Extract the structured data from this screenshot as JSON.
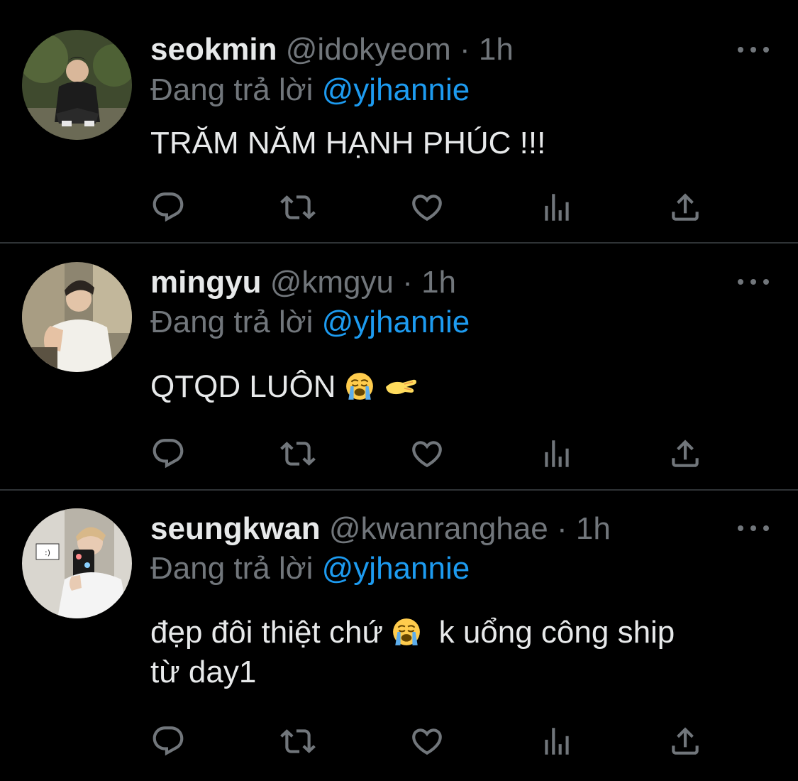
{
  "tweets": [
    {
      "display_name": "seokmin",
      "handle": "@idokyeom",
      "separator": "·",
      "time": "1h",
      "reply_prefix": "Đang trả lời",
      "reply_to": "@yjhannie",
      "text": "TRĂM NĂM HẠNH PHÚC !!!",
      "text_suffix": ""
    },
    {
      "display_name": "mingyu",
      "handle": "@kmgyu",
      "separator": "·",
      "time": "1h",
      "reply_prefix": "Đang trả lời",
      "reply_to": "@yjhannie",
      "text": "QTQD LUÔN",
      "emojis": [
        "loudly-crying-face",
        "pinching-hand"
      ]
    },
    {
      "display_name": "seungkwan",
      "handle": "@kwanranghae",
      "separator": "·",
      "time": "1h",
      "reply_prefix": "Đang trả lời",
      "reply_to": "@yjhannie",
      "text": "đẹp đôi thiệt chứ",
      "text_after_emoji": "k uổng công ship",
      "text_line2": "từ day1",
      "emojis": [
        "loudly-crying-face"
      ]
    }
  ],
  "action_icons": [
    "reply-icon",
    "retweet-icon",
    "like-icon",
    "analytics-icon",
    "share-icon"
  ],
  "colors": {
    "background": "#000000",
    "text": "#e7e9ea",
    "muted": "#71767b",
    "mention": "#1d9bf0",
    "divider": "#2f3336"
  }
}
